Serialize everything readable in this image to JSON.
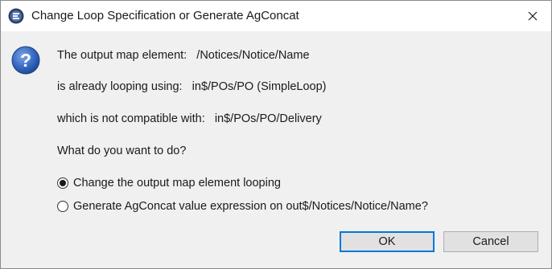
{
  "window": {
    "title": "Change Loop Specification or Generate AgConcat"
  },
  "icons": {
    "app": "application-icon",
    "close": "close-icon",
    "question": "question-icon"
  },
  "message": {
    "line1": "The output map element:   /Notices/Notice/Name",
    "line2": "is already looping using:   in$/POs/PO (SimpleLoop)",
    "line3": "which is not compatible with:   in$/POs/PO/Delivery",
    "line4": "What do you want to do?"
  },
  "options": [
    {
      "label": "Change the output map element looping",
      "selected": true
    },
    {
      "label": "Generate AgConcat value expression on out$/Notices/Notice/Name?",
      "selected": false
    }
  ],
  "buttons": {
    "ok": "OK",
    "cancel": "Cancel"
  },
  "colors": {
    "accent": "#0078d7",
    "client_bg": "#f0f0f0",
    "question_icon": "#2a5db3"
  }
}
